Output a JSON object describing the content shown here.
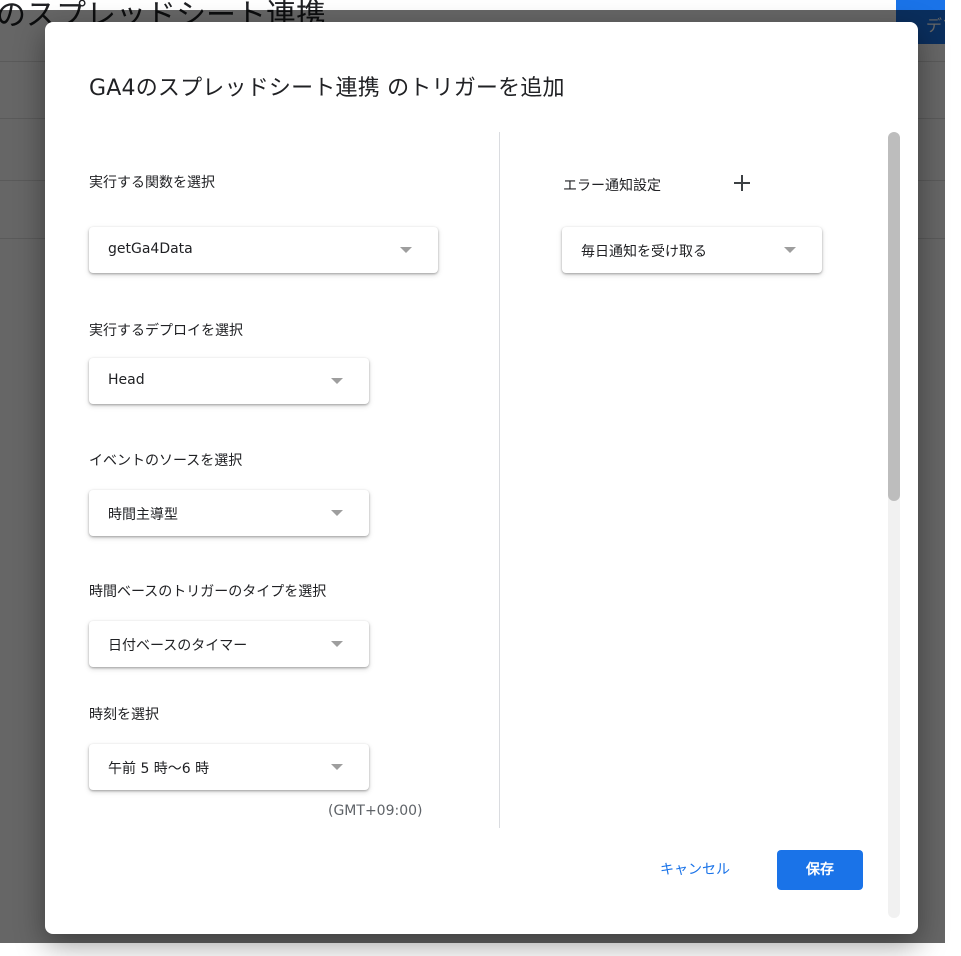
{
  "background": {
    "title": "のスプレッドシート連携",
    "deploy_button": "デプ"
  },
  "dialog": {
    "title": "GA4のスプレッドシート連携 のトリガーを追加",
    "function_field": {
      "label": "実行する関数を選択",
      "value": "getGa4Data"
    },
    "deploy_field": {
      "label": "実行するデプロイを選択",
      "value": "Head"
    },
    "event_source_field": {
      "label": "イベントのソースを選択",
      "value": "時間主導型"
    },
    "time_trigger_type_field": {
      "label": "時間ベースのトリガーのタイプを選択",
      "value": "日付ベースのタイマー"
    },
    "time_of_day_field": {
      "label": "時刻を選択",
      "value": "午前 5 時～6 時",
      "timezone": "(GMT+09:00)"
    },
    "error_notification": {
      "label": "エラー通知設定",
      "value": "毎日通知を受け取る"
    },
    "buttons": {
      "cancel": "キャンセル",
      "save": "保存"
    }
  },
  "icons": {
    "plus": "plus-icon",
    "dropdown": "arrow-drop-down-icon"
  },
  "colors": {
    "accent": "#1a73e8",
    "overlay": "rgba(0,0,0,0.6)"
  },
  "scrollbar": {
    "position_fraction": 0.0,
    "visible_fraction": 0.47
  }
}
